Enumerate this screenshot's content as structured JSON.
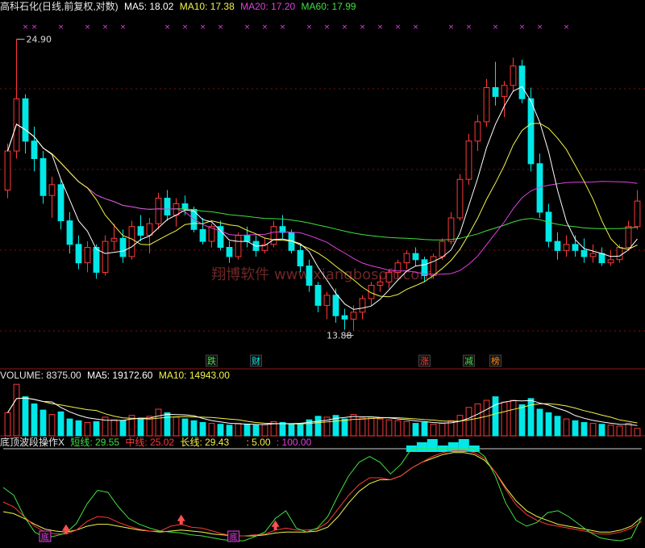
{
  "price_header": {
    "title": "高科石化(日线,前复权,对数)",
    "ma5": "MA5: 18.02",
    "ma10": "MA10: 17.38",
    "ma20": "MA20: 17.20",
    "ma60": "MA60: 17.99"
  },
  "volume_header": {
    "title": "VOLUME: 8375.00",
    "ma5": "MA5: 19172.60",
    "ma10": "MA10: 14943.00"
  },
  "indicator_header": {
    "title": "底顶波段操作X",
    "short": "短线: 29.55",
    "mid": "中线: 25.02",
    "long": "长线: 29.43",
    "v1": ": 5.00",
    "v2": ": 100.00"
  },
  "watermark": "翔博软件 www.xiangbosoft.com",
  "price_labels": {
    "high": "24.90",
    "low": "13.88"
  },
  "signals": [
    "跌",
    "财",
    "涨",
    "减",
    "榜"
  ],
  "indicator_marks": [
    "底",
    "底"
  ],
  "chart_data": [
    {
      "type": "candlestick",
      "title": "高科石化(日线,前复权,对数)",
      "scale": "log",
      "ylim": [
        13.0,
        26.0
      ],
      "grid": true,
      "annotations": [
        {
          "label": "24.90",
          "kind": "high"
        },
        {
          "label": "13.88",
          "kind": "low"
        }
      ],
      "ma": {
        "MA5": 18.02,
        "MA10": 17.38,
        "MA20": 17.2,
        "MA60": 17.99
      },
      "colors": {
        "up": "#ff3838",
        "down": "#00e8e8",
        "MA5": "#ffffff",
        "MA10": "#f3f34a",
        "MA20": "#e040e0",
        "MA60": "#40e040"
      },
      "candles": [
        [
          18.4,
          20.2,
          18.1,
          19.9
        ],
        [
          19.9,
          24.9,
          19.6,
          22.1
        ],
        [
          22.1,
          22.3,
          19.8,
          20.3
        ],
        [
          20.3,
          20.9,
          19.1,
          19.6
        ],
        [
          19.6,
          19.9,
          17.9,
          18.2
        ],
        [
          18.2,
          18.9,
          17.4,
          18.6
        ],
        [
          18.6,
          18.8,
          17.0,
          17.3
        ],
        [
          17.3,
          17.6,
          16.2,
          16.5
        ],
        [
          16.5,
          16.8,
          15.7,
          15.9
        ],
        [
          15.9,
          16.6,
          15.6,
          16.4
        ],
        [
          16.4,
          16.5,
          15.4,
          15.6
        ],
        [
          15.6,
          16.8,
          15.5,
          16.6
        ],
        [
          16.6,
          17.2,
          16.3,
          16.7
        ],
        [
          16.7,
          17.0,
          15.9,
          16.1
        ],
        [
          16.1,
          17.3,
          16.0,
          17.1
        ],
        [
          17.1,
          17.5,
          16.6,
          16.8
        ],
        [
          16.8,
          17.4,
          16.2,
          17.2
        ],
        [
          17.2,
          18.3,
          17.0,
          18.1
        ],
        [
          18.1,
          18.4,
          17.3,
          17.5
        ],
        [
          17.5,
          18.1,
          17.1,
          17.9
        ],
        [
          17.9,
          18.2,
          17.5,
          17.7
        ],
        [
          17.7,
          17.8,
          16.9,
          17.0
        ],
        [
          17.0,
          17.4,
          16.5,
          16.6
        ],
        [
          16.6,
          17.2,
          16.4,
          17.1
        ],
        [
          17.1,
          17.3,
          16.3,
          16.4
        ],
        [
          16.4,
          16.6,
          15.9,
          16.1
        ],
        [
          16.1,
          16.9,
          16.0,
          16.8
        ],
        [
          16.8,
          17.1,
          16.4,
          16.6
        ],
        [
          16.6,
          16.8,
          16.1,
          16.3
        ],
        [
          16.3,
          16.7,
          16.2,
          16.5
        ],
        [
          16.5,
          17.3,
          16.4,
          17.1
        ],
        [
          17.1,
          17.5,
          16.7,
          16.9
        ],
        [
          16.9,
          17.0,
          16.2,
          16.3
        ],
        [
          16.3,
          16.5,
          15.6,
          15.8
        ],
        [
          15.8,
          16.0,
          15.0,
          15.2
        ],
        [
          15.2,
          15.3,
          14.4,
          14.6
        ],
        [
          14.6,
          15.0,
          14.2,
          14.9
        ],
        [
          14.9,
          15.1,
          14.1,
          14.3
        ],
        [
          14.3,
          14.5,
          13.9,
          14.2
        ],
        [
          14.2,
          14.6,
          13.88,
          14.4
        ],
        [
          14.4,
          14.9,
          14.2,
          14.8
        ],
        [
          14.8,
          15.3,
          14.6,
          15.2
        ],
        [
          15.2,
          15.5,
          15.0,
          15.3
        ],
        [
          15.3,
          15.7,
          15.1,
          15.6
        ],
        [
          15.6,
          16.0,
          15.4,
          15.9
        ],
        [
          15.9,
          16.3,
          15.7,
          16.2
        ],
        [
          16.2,
          16.4,
          15.8,
          16.0
        ],
        [
          16.0,
          16.1,
          15.3,
          15.5
        ],
        [
          15.5,
          16.2,
          15.4,
          16.1
        ],
        [
          16.1,
          16.7,
          16.0,
          16.6
        ],
        [
          16.6,
          17.6,
          16.5,
          17.4
        ],
        [
          17.4,
          19.0,
          17.3,
          18.8
        ],
        [
          18.8,
          20.6,
          18.6,
          20.3
        ],
        [
          20.3,
          21.4,
          19.9,
          21.1
        ],
        [
          21.1,
          23.0,
          20.9,
          22.6
        ],
        [
          22.6,
          23.8,
          21.8,
          22.2
        ],
        [
          22.2,
          22.9,
          21.3,
          22.7
        ],
        [
          22.7,
          24.0,
          22.4,
          23.6
        ],
        [
          23.6,
          23.9,
          21.9,
          22.1
        ],
        [
          22.1,
          22.6,
          19.1,
          19.4
        ],
        [
          19.4,
          19.8,
          17.4,
          17.6
        ],
        [
          17.6,
          17.9,
          16.4,
          16.6
        ],
        [
          16.6,
          16.9,
          16.0,
          16.3
        ],
        [
          16.3,
          16.8,
          16.1,
          16.5
        ],
        [
          16.5,
          16.8,
          16.1,
          16.3
        ],
        [
          16.3,
          16.7,
          15.9,
          16.1
        ],
        [
          16.1,
          16.5,
          15.9,
          16.2
        ],
        [
          16.2,
          16.4,
          15.8,
          15.9
        ],
        [
          15.9,
          16.3,
          15.8,
          16.0
        ],
        [
          16.0,
          16.5,
          15.9,
          16.4
        ],
        [
          16.4,
          17.3,
          16.3,
          17.1
        ],
        [
          17.1,
          18.4,
          17.0,
          18.0
        ]
      ]
    },
    {
      "type": "bar",
      "title": "VOLUME: 8375.00",
      "ylim": [
        0,
        60000
      ],
      "ma": {
        "MA5": 19172.6,
        "MA10": 14943.0
      },
      "colors": {
        "up": "#ff3838",
        "down": "#00e8e8",
        "MA5": "#ffffff",
        "MA10": "#f3f34a"
      },
      "values": [
        26000,
        58000,
        44000,
        36000,
        29000,
        24000,
        27000,
        19000,
        17000,
        15000,
        16000,
        21000,
        18000,
        17000,
        23000,
        20000,
        22000,
        30000,
        26000,
        21000,
        19000,
        17000,
        15000,
        14000,
        13000,
        12000,
        14000,
        13000,
        12000,
        12500,
        16000,
        15000,
        13000,
        14000,
        18000,
        22000,
        21000,
        23000,
        19000,
        24000,
        20000,
        21000,
        19000,
        18000,
        17000,
        16000,
        14000,
        15000,
        13000,
        14000,
        17000,
        23000,
        32000,
        36000,
        40000,
        44000,
        38000,
        40000,
        35000,
        42000,
        30000,
        26000,
        22000,
        19000,
        17000,
        15000,
        14000,
        13000,
        12000,
        11000,
        14000,
        8375
      ]
    },
    {
      "type": "line",
      "title": "底顶波段操作X",
      "ylim": [
        0,
        100
      ],
      "levels": [
        5,
        100
      ],
      "series": [
        {
          "name": "短线",
          "color": "#40e040",
          "values": [
            60,
            52,
            30,
            14,
            8,
            10,
            13,
            23,
            43,
            57,
            55,
            40,
            28,
            22,
            18,
            15,
            14,
            13,
            11,
            10,
            8,
            6,
            5,
            5,
            9,
            14,
            28,
            36,
            18,
            14,
            18,
            30,
            52,
            72,
            86,
            92,
            86,
            74,
            84,
            100,
            100,
            100,
            100,
            100,
            100,
            100,
            92,
            72,
            44,
            26,
            20,
            24,
            34,
            36,
            30,
            22,
            14,
            8,
            6,
            5,
            8,
            29.55
          ]
        },
        {
          "name": "中线",
          "color": "#ff3838",
          "values": [
            45,
            40,
            30,
            20,
            14,
            12,
            12,
            16,
            25,
            30,
            29,
            24,
            20,
            17,
            15,
            15,
            20,
            22,
            19,
            18,
            15,
            12,
            10,
            10,
            11,
            12,
            16,
            18,
            16,
            16,
            17,
            24,
            38,
            52,
            63,
            70,
            70,
            68,
            72,
            80,
            86,
            92,
            96,
            98,
            98,
            96,
            90,
            76,
            58,
            42,
            32,
            26,
            22,
            20,
            18,
            16,
            14,
            12,
            12,
            14,
            18,
            25.02
          ]
        },
        {
          "name": "长线",
          "color": "#f3f34a",
          "values": [
            35,
            33,
            28,
            22,
            17,
            15,
            14,
            16,
            20,
            22,
            22,
            20,
            18,
            16,
            15,
            14,
            15,
            16,
            15,
            14,
            12,
            11,
            10,
            10,
            10,
            11,
            13,
            14,
            14,
            14,
            15,
            19,
            30,
            44,
            56,
            64,
            68,
            68,
            72,
            80,
            86,
            90,
            94,
            96,
            96,
            94,
            88,
            76,
            60,
            46,
            36,
            30,
            26,
            22,
            20,
            18,
            16,
            14,
            14,
            16,
            20,
            29.43
          ]
        }
      ]
    }
  ]
}
